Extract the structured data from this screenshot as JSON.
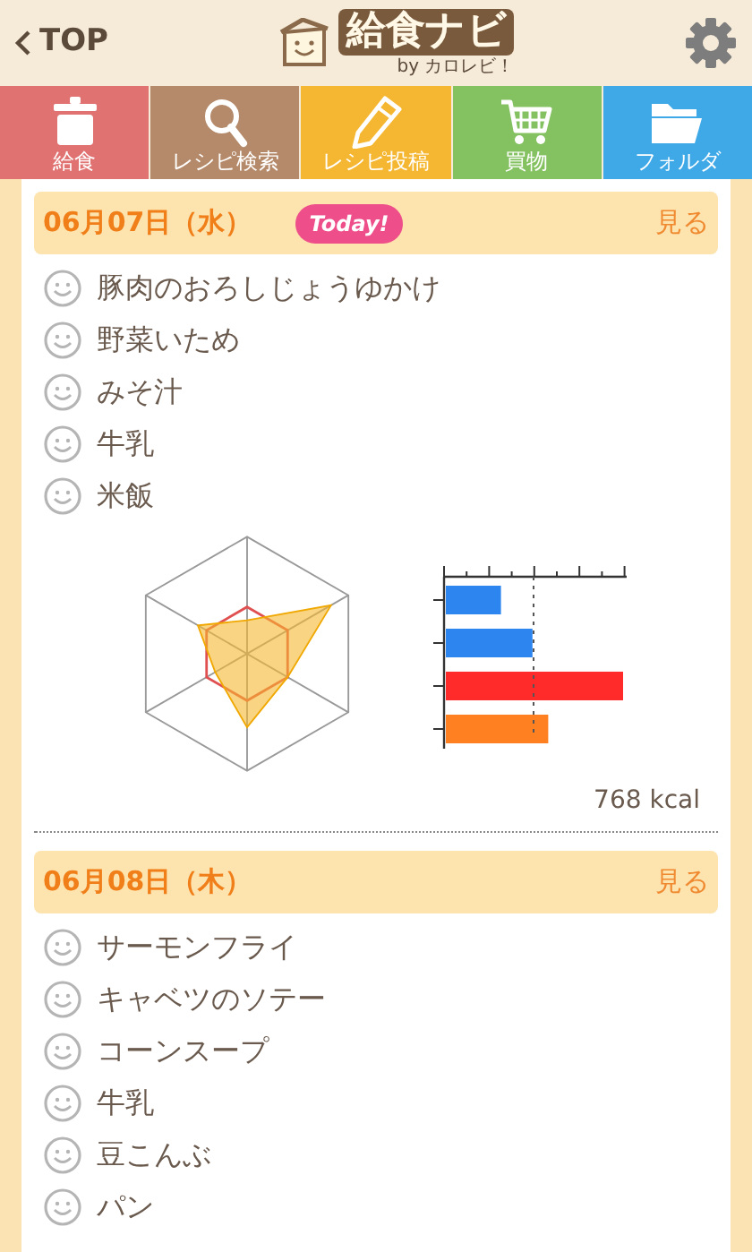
{
  "header": {
    "back": "TOP",
    "logo": "給食ナビ",
    "byline": "by カロレビ！"
  },
  "tabs": [
    {
      "label": "給食",
      "color": "#e07272"
    },
    {
      "label": "レシピ検索",
      "color": "#b58a6a"
    },
    {
      "label": "レシピ投稿",
      "color": "#f5b731"
    },
    {
      "label": "買物",
      "color": "#84c160"
    },
    {
      "label": "フォルダ",
      "color": "#3fa9e8"
    }
  ],
  "days": [
    {
      "date": "06月07日（水）",
      "today": true,
      "today_label": "Today!",
      "view": "見る",
      "menu": [
        "豚肉のおろしじょうゆかけ",
        "野菜いため",
        "みそ汁",
        "牛乳",
        "米飯"
      ],
      "kcal": "768 kcal"
    },
    {
      "date": "06月08日（木）",
      "today": false,
      "view": "見る",
      "menu": [
        "サーモンフライ",
        "キャベツのソテー",
        "コーンスープ",
        "牛乳",
        "豆こんぶ",
        "パン"
      ]
    }
  ]
}
